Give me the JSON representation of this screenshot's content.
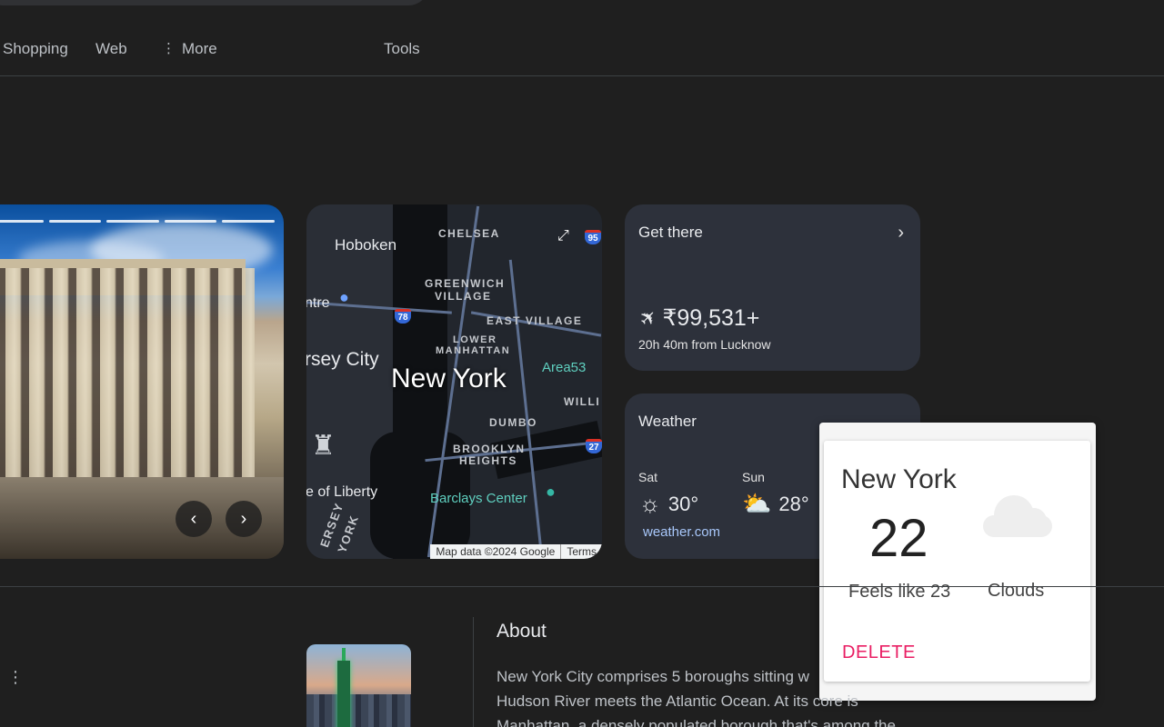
{
  "tabs": {
    "shopping": "Shopping",
    "web": "Web",
    "more": "More",
    "tools": "Tools"
  },
  "photo_card": {
    "prev_icon": "chevron-left-icon",
    "next_icon": "chevron-right-icon",
    "slides_visible": 5
  },
  "map": {
    "labels": {
      "hoboken": "Hoboken",
      "chelsea": "CHELSEA",
      "greenwich1": "GREENWICH",
      "greenwich2": "VILLAGE",
      "east_village": "EAST VILLAGE",
      "lower1": "LOWER",
      "lower2": "MANHATTAN",
      "centre": "ntre",
      "jersey_city": "rsey City",
      "new_york": "New York",
      "area53": "Area53",
      "willi": "WILLI",
      "dumbo": "DUMBO",
      "brooklyn1": "BROOKLYN",
      "brooklyn2": "HEIGHTS",
      "liberty": "e of Liberty",
      "barclays": "Barclays Center",
      "jersey_v": "ERSEY",
      "york_v": "YORK"
    },
    "shields": {
      "i78": "78",
      "i95": "95",
      "i278": "27"
    },
    "attribution": "Map data ©2024 Google",
    "terms": "Terms"
  },
  "get_there": {
    "title": "Get there",
    "price": "₹99,531+",
    "duration": "20h 40m from Lucknow"
  },
  "weather_card": {
    "title": "Weather",
    "days": [
      {
        "day": "Sat",
        "temp": "30°",
        "icon": "sunny-icon"
      },
      {
        "day": "Sun",
        "temp": "28°",
        "icon": "partly-cloudy-icon"
      }
    ],
    "source": "weather.com"
  },
  "popup": {
    "city": "New York",
    "temp": "22",
    "feels_like": "Feels like 23",
    "condition": "Clouds",
    "delete_label": "DELETE"
  },
  "about": {
    "title": "About",
    "lines": [
      "New York City comprises 5 boroughs sitting w",
      "Hudson River meets the Atlantic Ocean. At its core is",
      "Manhattan, a densely populated borough that's among the"
    ]
  },
  "colors": {
    "background": "#1f1f1f",
    "card": "#2d313b",
    "link": "#a8c7fa",
    "delete": "#e91e63"
  }
}
